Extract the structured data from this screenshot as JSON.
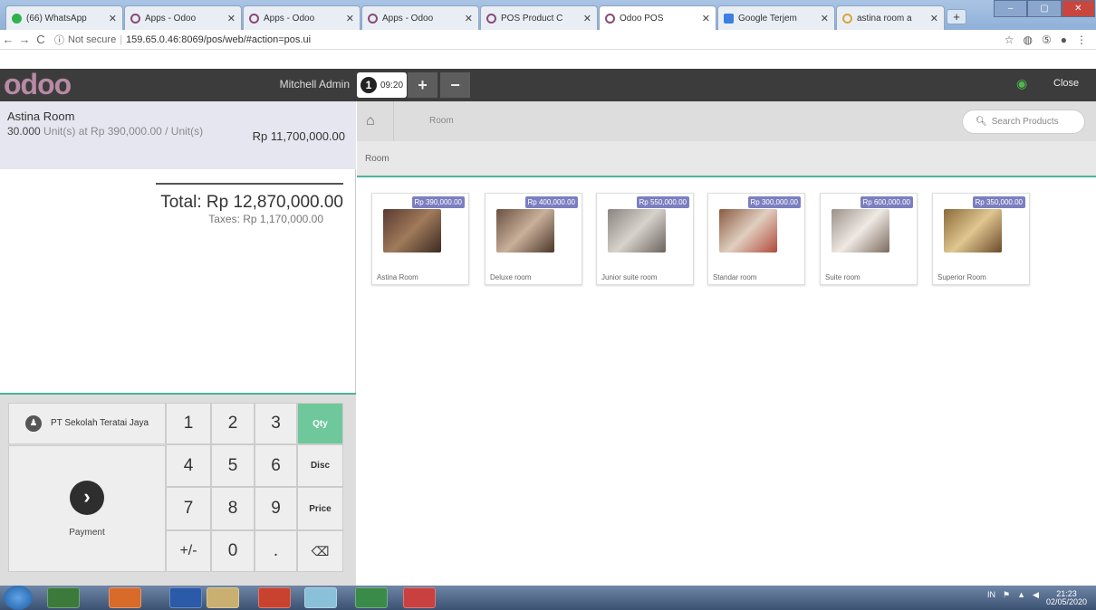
{
  "browser": {
    "tabs": [
      {
        "label": "(66) WhatsApp",
        "color": "#2fb24b"
      },
      {
        "label": "Apps - Odoo",
        "color": "#8a4a78"
      },
      {
        "label": "Apps - Odoo",
        "color": "#8a4a78"
      },
      {
        "label": "Apps - Odoo",
        "color": "#8a4a78"
      },
      {
        "label": "POS Product C",
        "color": "#8a4a78"
      },
      {
        "label": "Odoo POS",
        "color": "#8a4a78"
      },
      {
        "label": "Google Terjem",
        "color": "#3b7fe0"
      },
      {
        "label": "astina room a",
        "color": "#d9a63a"
      }
    ],
    "not_secure": "Not secure",
    "url": "159.65.0.46:8069/pos/web/#action=pos.ui"
  },
  "header": {
    "logo": "odoo",
    "user": "Mitchell Admin",
    "order_number": "1",
    "order_time": "09:20",
    "add_label": "+",
    "remove_label": "−",
    "close_label": "Close"
  },
  "order": {
    "line": {
      "name": "Astina Room",
      "qty": "30.000",
      "unit_text": "Unit(s) at Rp 390,000.00 / Unit(s)",
      "price": "Rp 11,700,000.00"
    },
    "total": "Total: Rp 12,870,000.00",
    "taxes": "Taxes: Rp 1,170,000.00"
  },
  "pad": {
    "customer": "PT Sekolah Teratai Jaya",
    "payment": "Payment",
    "keys": [
      "1",
      "2",
      "3",
      "Qty",
      "4",
      "5",
      "6",
      "Disc",
      "7",
      "8",
      "9",
      "Price",
      "+/-",
      "0",
      ".",
      "⌫"
    ]
  },
  "catalog": {
    "breadcrumb": "Room",
    "category": "Room",
    "search_placeholder": "Search Products",
    "products": [
      {
        "name": "Astina Room",
        "price": "Rp 390,000.00",
        "color": "#7a5a4a"
      },
      {
        "name": "Deluxe room",
        "price": "Rp 400,000.00",
        "color": "#8f7460"
      },
      {
        "name": "Junior suite room",
        "price": "Rp 550,000.00",
        "color": "#9c9590"
      },
      {
        "name": "Standar room",
        "price": "Rp 300,000.00",
        "color": "#a5806a"
      },
      {
        "name": "Suite room",
        "price": "Rp 600,000.00",
        "color": "#b8aea6"
      },
      {
        "name": "Superior Room",
        "price": "Rp 350,000.00",
        "color": "#b0884e"
      }
    ]
  },
  "taskbar": {
    "lang": "IN",
    "time": "21:23",
    "date": "02/05/2020"
  }
}
